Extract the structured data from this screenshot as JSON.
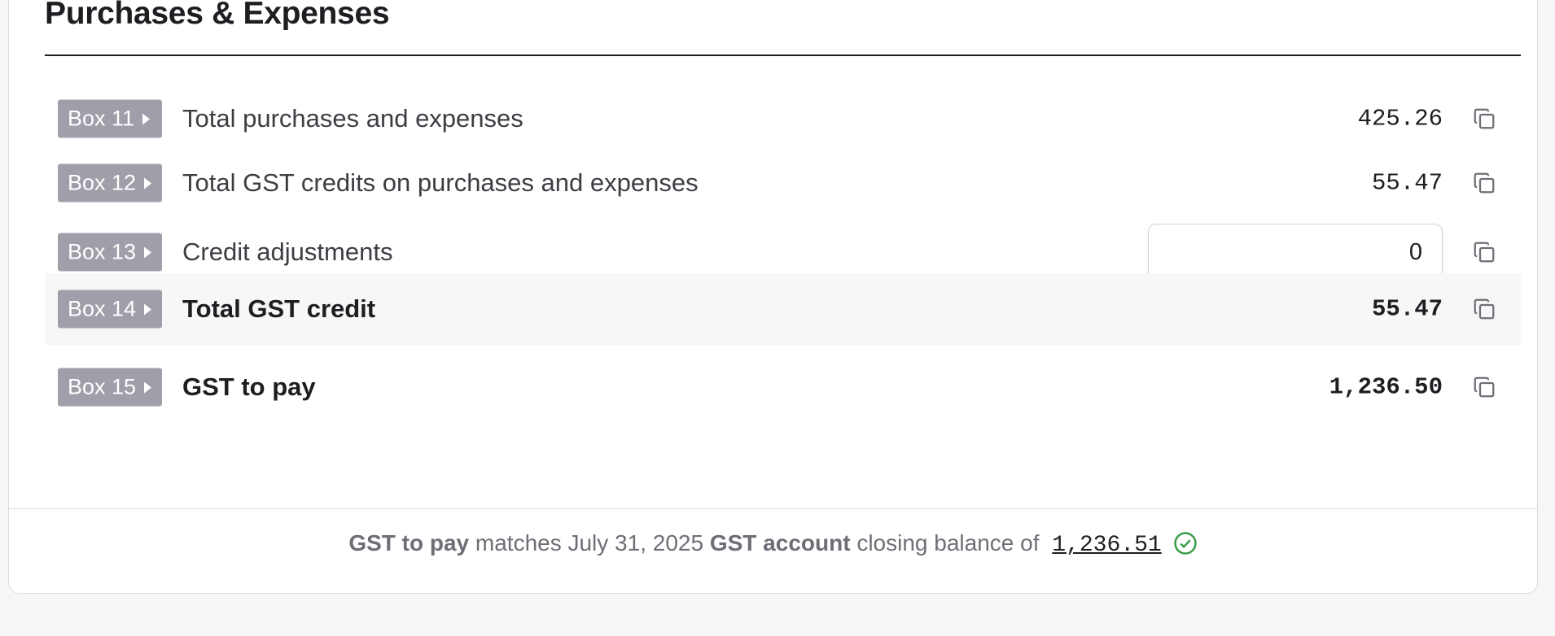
{
  "section": {
    "title": "Purchases & Expenses"
  },
  "rows": [
    {
      "box": "Box 11",
      "label": "Total purchases and expenses",
      "value": "425.26"
    },
    {
      "box": "Box 12",
      "label": "Total GST credits on purchases and expenses",
      "value": "55.47"
    },
    {
      "box": "Box 13",
      "label": "Credit adjustments",
      "input_value": "0"
    },
    {
      "box": "Box 14",
      "label": "Total GST credit",
      "value": "55.47"
    },
    {
      "box": "Box 15",
      "label": "GST to pay",
      "value": "1,236.50"
    }
  ],
  "footer": {
    "part1": "GST to pay",
    "part2": " matches July 31, 2025 ",
    "part3": "GST account",
    "part4": " closing balance of ",
    "balance": "1,236.51",
    "status_icon": "check-circle-icon"
  },
  "colors": {
    "box_badge": "#9e9fa8",
    "check": "#3a9d4a",
    "highlight_row": "#f7f7f8"
  },
  "icons": {
    "copy": "copy-icon",
    "caret": "caret-right-icon"
  }
}
